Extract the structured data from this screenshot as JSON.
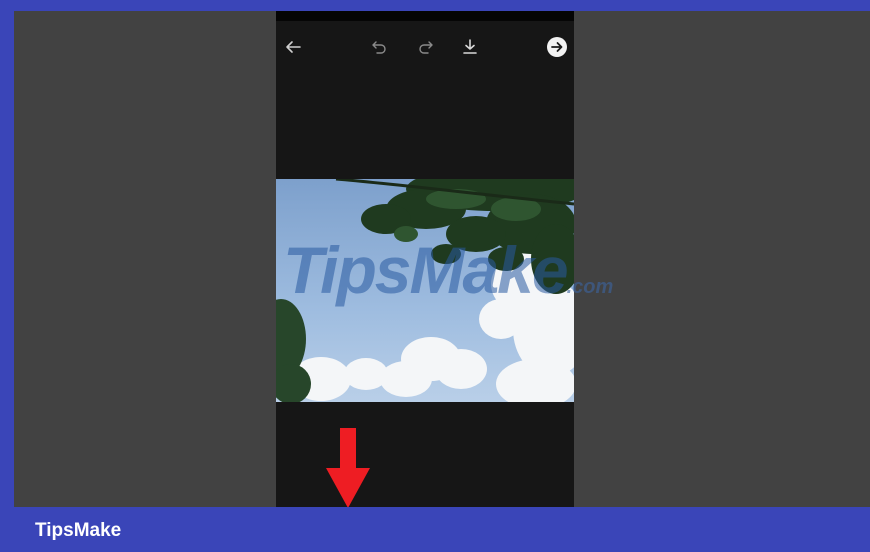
{
  "toolbar": {
    "icons": [
      "back-arrow-icon",
      "undo-icon",
      "redo-icon",
      "download-icon",
      "next-arrow-icon"
    ]
  },
  "watermark": {
    "main": "TipsMake",
    "suffix": ".com"
  },
  "footer": {
    "brand": "TipsMake"
  },
  "colors": {
    "border": "#3a45b8",
    "stage": "#424242",
    "phone_bg": "#161616",
    "annotation_red": "#ee1d23"
  }
}
